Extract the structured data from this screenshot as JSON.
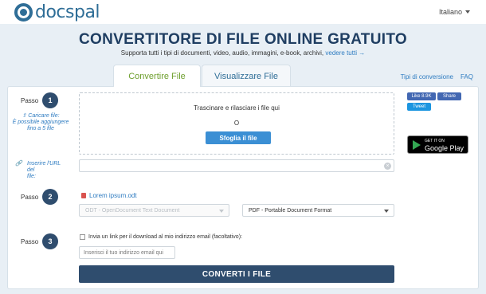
{
  "header": {
    "logo_text": "docspal",
    "language": "Italiano"
  },
  "hero": {
    "title": "CONVERTITORE DI FILE ONLINE GRATUITO",
    "subtitle": "Supporta tutti i tipi di documenti, video, audio, immagini, e-book, archivi,",
    "subtitle_link": "vedere tutti →"
  },
  "tabs": [
    {
      "label": "Convertire File",
      "active": true
    },
    {
      "label": "Visualizzare File",
      "active": false
    }
  ],
  "right_links": {
    "conversion_types": "Tipi di conversione",
    "faq": "FAQ"
  },
  "steps": {
    "step_label": "Passo",
    "step1": "1",
    "step2": "2",
    "step3": "3"
  },
  "upload": {
    "side_link": "Caricare file:",
    "side_note_1": "È possibile aggiungere",
    "side_note_2": "fino a 5 file",
    "drop_text": "Trascinare e rilasciare i file qui",
    "or_text": "O",
    "browse_button": "Sfoglia il file"
  },
  "url": {
    "label_1": "Inserire l'URL del",
    "label_2": "file:",
    "value": ""
  },
  "file": {
    "name": "Lorem ipsum.odt"
  },
  "formats": {
    "from": "ODT - OpenDocument Text Document",
    "to": "PDF - Portable Document Format"
  },
  "email": {
    "checkbox_label": "Invia un link per il download al mio indirizzo email (facoltativo):",
    "placeholder": "Inserisci il tuo indirizzo email qui"
  },
  "convert_button": "CONVERTI I FILE",
  "social": {
    "fb_like": "Like 8.9K",
    "fb_share": "Share",
    "tweet": "Tweet"
  },
  "google_play": {
    "small": "GET IT ON",
    "big": "Google Play"
  },
  "colors": {
    "primary_dark": "#2f4d6e",
    "accent_blue": "#3b8fd4",
    "tab_active_green": "#6e9f2e",
    "hero_bg": "#e8eff5"
  }
}
